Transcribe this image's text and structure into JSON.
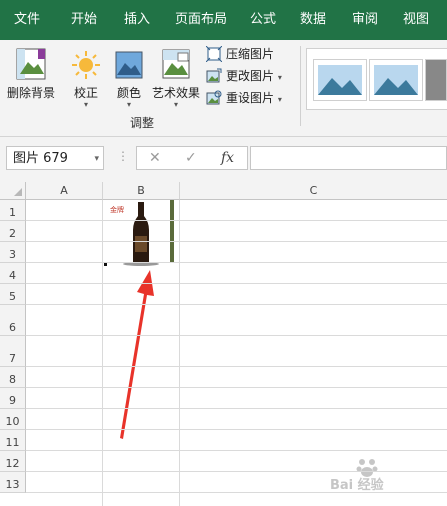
{
  "ribbon_tabs": [
    "文件",
    "开始",
    "插入",
    "页面布局",
    "公式",
    "数据",
    "审阅",
    "视图"
  ],
  "ribbon": {
    "remove_background": "删除背景",
    "corrections": "校正",
    "color": "颜色",
    "artistic_effects": "艺术效果",
    "compress": "压缩图片",
    "change": "更改图片",
    "reset": "重设图片",
    "group_label": "调整",
    "dropdown_glyph": "▾"
  },
  "formula_bar": {
    "name_box": "图片 679",
    "cancel_glyph": "✕",
    "enter_glyph": "✓",
    "fx_glyph": "fx",
    "formula_value": ""
  },
  "grid": {
    "columns": [
      "A",
      "B",
      "C"
    ],
    "rows": [
      "1",
      "2",
      "3",
      "4",
      "5",
      "6",
      "7",
      "8",
      "9",
      "10",
      "11",
      "12",
      "13"
    ]
  },
  "picture": {
    "caption_text": "金牌"
  },
  "watermark": {
    "text": "Bai 经验"
  },
  "colors": {
    "accent": "#217346",
    "arrow": "#e8332a"
  }
}
